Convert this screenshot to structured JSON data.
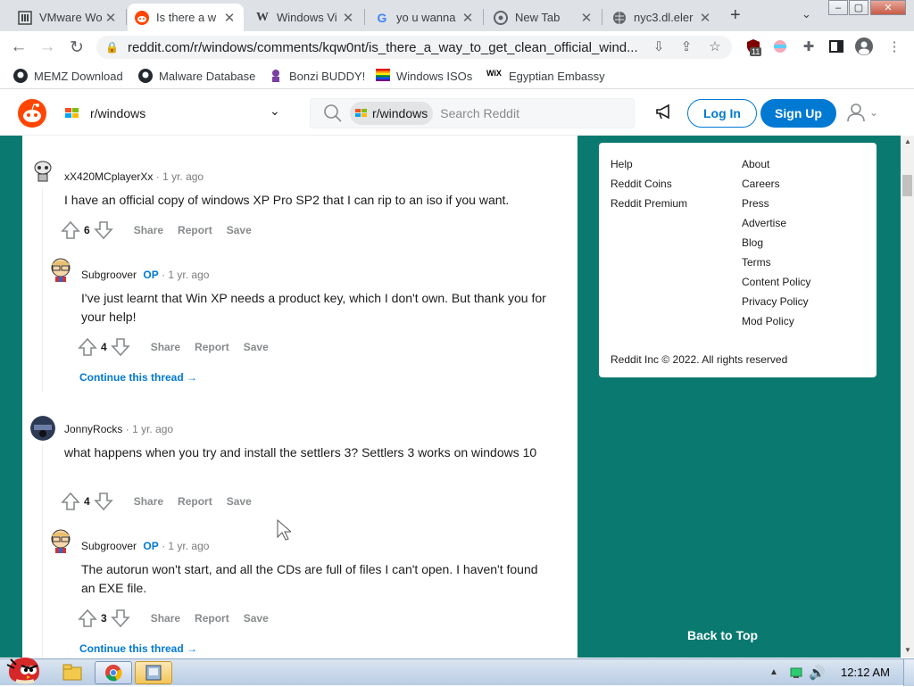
{
  "browser": {
    "tabs": [
      {
        "title": "VMware Wo",
        "icon": "vmware-icon",
        "active": false
      },
      {
        "title": "Is there a w",
        "icon": "reddit-icon",
        "active": true
      },
      {
        "title": "Windows Vi",
        "icon": "wikipedia-icon",
        "active": false
      },
      {
        "title": "yo u wanna",
        "icon": "google-icon",
        "active": false
      },
      {
        "title": "New Tab",
        "icon": "chrome-icon",
        "active": false
      },
      {
        "title": "nyc3.dl.eler",
        "icon": "globe-icon",
        "active": false
      }
    ],
    "new_tab": "+",
    "url": "reddit.com/r/windows/comments/kqw0nt/is_there_a_way_to_get_clean_official_wind...",
    "ext_badge": "11",
    "bookmarks": [
      {
        "label": "MEMZ Download",
        "icon": "github-icon"
      },
      {
        "label": "Malware Database",
        "icon": "github-icon"
      },
      {
        "label": "Bonzi BUDDY!",
        "icon": "bonzi-icon"
      },
      {
        "label": "Windows ISOs",
        "icon": "rainbow-flag-icon"
      },
      {
        "label": "Egyptian Embassy",
        "icon": "wix-icon"
      }
    ],
    "wix_mark": "WiX"
  },
  "reddit_header": {
    "subreddit": "r/windows",
    "search_chip": "r/windows",
    "search_placeholder": "Search Reddit",
    "login": "Log In",
    "signup": "Sign Up"
  },
  "comments": [
    {
      "author": "xX420MCplayerXx",
      "op": "",
      "time": "1 yr. ago",
      "text": "I have an official copy of windows XP Pro SP2 that I can rip to an iso if you want.",
      "votes": "6",
      "avatar": "snoo-avatar"
    },
    {
      "author": "Subgroover",
      "op": "OP",
      "time": "1 yr. ago",
      "text": "I've just learnt that Win XP needs a product key, which I don't own. But thank you for your help!",
      "votes": "4",
      "avatar": "glasses-avatar"
    },
    {
      "author": "JonnyRocks",
      "op": "",
      "time": "1 yr. ago",
      "text": "what happens when you try and install the settlers 3? Settlers 3 works on windows 10",
      "votes": "4",
      "avatar": "dark-avatar"
    },
    {
      "author": "Subgroover",
      "op": "OP",
      "time": "1 yr. ago",
      "text": "The autorun won't start, and all the CDs are full of files I can't open. I haven't found an EXE file.",
      "votes": "3",
      "avatar": "glasses-avatar"
    }
  ],
  "actions": {
    "share": "Share",
    "report": "Report",
    "save": "Save",
    "dot": "·"
  },
  "continue_thread": "Continue this thread →",
  "footer": {
    "left": [
      "Help",
      "Reddit Coins",
      "Reddit Premium"
    ],
    "right": [
      "About",
      "Careers",
      "Press",
      "Advertise",
      "Blog",
      "Terms",
      "Content Policy",
      "Privacy Policy",
      "Mod Policy"
    ],
    "copyright": "Reddit Inc © 2022. All rights reserved"
  },
  "back_to_top": "Back to Top",
  "taskbar": {
    "time": "12:12 AM"
  },
  "colors": {
    "reddit_blue": "#0079d3",
    "community_bg": "#0a7a71",
    "reddit_orange": "#ff4500"
  }
}
